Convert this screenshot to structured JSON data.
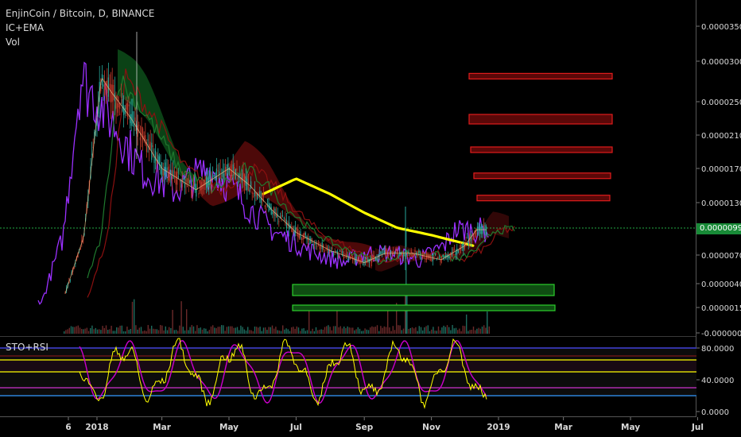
{
  "header": {
    "title": "EnjinCoin / Bitcoin, D, BINANCE",
    "study1": "IC+EMA",
    "study2": "Vol"
  },
  "sub_pane": {
    "title": "STO+RSI"
  },
  "last_price": "0.00000998",
  "chart_data": [
    {
      "type": "line",
      "title": "EnjinCoin / Bitcoin, D, BINANCE",
      "price_axis_ticks": [
        "0.00003500",
        "0.00003000",
        "0.00002500",
        "0.00002100",
        "0.00001700",
        "0.00001300",
        "0.00000998",
        "0.00000700",
        "0.00000400",
        "0.00000150",
        "-0.00000090"
      ],
      "time_axis_ticks": [
        "6",
        "2018",
        "Mar",
        "May",
        "Jul",
        "Sep",
        "Nov",
        "2019",
        "Mar",
        "May",
        "Jul"
      ],
      "last_price": 9.98e-06,
      "price_approx": {
        "x": [
          "2017-11-01",
          "2017-12-01",
          "2017-12-20",
          "2018-01-05",
          "2018-01-15",
          "2018-02-01",
          "2018-03-01",
          "2018-04-01",
          "2018-05-01",
          "2018-05-20",
          "2018-06-10",
          "2018-07-01",
          "2018-08-01",
          "2018-09-01",
          "2018-09-20",
          "2018-10-15",
          "2018-11-10",
          "2018-12-01",
          "2018-12-12"
        ],
        "y": [
          2e-06,
          2.2e-06,
          9e-06,
          2.8e-05,
          2.6e-05,
          2.3e-05,
          1.7e-05,
          1.45e-05,
          1.7e-05,
          1.5e-05,
          1.2e-05,
          9.5e-06,
          7.5e-06,
          6.2e-06,
          7.2e-06,
          7.2e-06,
          6.5e-06,
          8e-06,
          9.8e-06
        ]
      },
      "ema_yellow": {
        "x": [
          "2018-06-01",
          "2018-07-01",
          "2018-08-01",
          "2018-09-01",
          "2018-10-01",
          "2018-11-01",
          "2018-12-10"
        ],
        "y": [
          1.4e-05,
          1.58e-05,
          1.4e-05,
          1.18e-05,
          1e-05,
          9.2e-06,
          8e-06
        ]
      },
      "resistance_zones": [
        2.8e-05,
        2.3e-05,
        1.91e-05,
        1.6e-05,
        1.34e-05
      ],
      "support_zones": [
        2.8e-06,
        1.5e-06
      ],
      "colors": {
        "resistance": "#e01c1c",
        "support": "#2ccf2c",
        "ema": "#ffff00",
        "price_line": "#14b84a",
        "lagging_span": "#9b30ff"
      }
    },
    {
      "type": "line",
      "title": "STO+RSI",
      "y_axis_ticks": [
        "80.0000",
        "40.0000",
        "0.0000"
      ],
      "ylim": [
        0,
        100
      ],
      "levels": [
        80,
        70,
        65,
        50,
        30,
        20
      ],
      "colors": {
        "stoch_k": "#ffff00",
        "stoch_d": "#cc00cc"
      }
    }
  ]
}
